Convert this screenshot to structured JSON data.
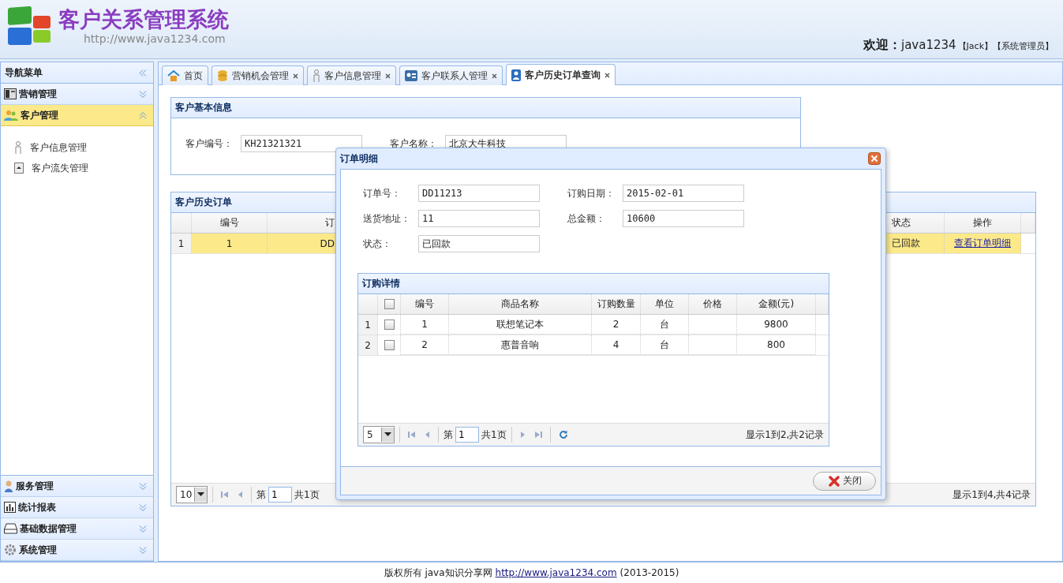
{
  "header": {
    "title": "客户关系管理系统",
    "url": "http://www.java1234.com",
    "welcome": {
      "label": "欢迎：",
      "user": "java1234",
      "name": "【Jack】",
      "role": "【系统管理员】"
    }
  },
  "sidebar": {
    "title": "导航菜单",
    "sections": [
      {
        "label": "营销管理",
        "expanded": false
      },
      {
        "label": "客户管理",
        "expanded": true,
        "children": [
          {
            "label": "客户信息管理"
          },
          {
            "label": "客户流失管理"
          }
        ]
      },
      {
        "label": "服务管理",
        "expanded": false
      },
      {
        "label": "统计报表",
        "expanded": false
      },
      {
        "label": "基础数据管理",
        "expanded": false
      },
      {
        "label": "系统管理",
        "expanded": false
      }
    ]
  },
  "tabs": [
    {
      "label": "首页",
      "selected": false,
      "closable": false
    },
    {
      "label": "营销机会管理",
      "selected": false,
      "closable": true
    },
    {
      "label": "客户信息管理",
      "selected": false,
      "closable": true
    },
    {
      "label": "客户联系人管理",
      "selected": false,
      "closable": true
    },
    {
      "label": "客户历史订单查询",
      "selected": true,
      "closable": true
    }
  ],
  "basic_info": {
    "title": "客户基本信息",
    "fields": [
      {
        "label": "客户编号：",
        "value": "KH21321321"
      },
      {
        "label": "客户名称：",
        "value": "北京大牛科技"
      }
    ]
  },
  "history": {
    "title": "客户历史订单",
    "columns": [
      "编号",
      "订",
      "状态",
      "操作"
    ],
    "rows": [
      {
        "index": "1",
        "selected": true,
        "cells": [
          "1",
          "DD",
          "已回款"
        ],
        "action": "查看订单明细"
      }
    ],
    "pager": {
      "page_size": "10",
      "page_label": "第",
      "page": "1",
      "total_pages": "共1页",
      "summary": "显示1到4,共4记录"
    }
  },
  "dialog": {
    "title": "订单明细",
    "fields": [
      {
        "label": "订单号：",
        "value": "DD11213"
      },
      {
        "label": "订购日期：",
        "value": "2015-02-01"
      },
      {
        "label": "送货地址：",
        "value": "11"
      },
      {
        "label": "总金额：",
        "value": "10600"
      },
      {
        "label": "状态：",
        "value": "已回款"
      }
    ],
    "detail": {
      "title": "订购详情",
      "select_all_checked": false,
      "columns": [
        "编号",
        "商品名称",
        "订购数量",
        "单位",
        "价格",
        "金额(元)"
      ],
      "rows": [
        {
          "index": "1",
          "checked": false,
          "cells": [
            "1",
            "联想笔记本",
            "2",
            "台",
            "",
            "9800"
          ]
        },
        {
          "index": "2",
          "checked": false,
          "cells": [
            "2",
            "惠普音响",
            "4",
            "台",
            "",
            "800"
          ]
        }
      ],
      "pager": {
        "page_size": "5",
        "page_label": "第",
        "page": "1",
        "total_pages": "共1页",
        "summary": "显示1到2,共2记录"
      }
    },
    "close_button": "关闭"
  },
  "footer": {
    "text": "版权所有 java知识分享网",
    "link": "http://www.java1234.com",
    "years": "(2013-2015)"
  }
}
